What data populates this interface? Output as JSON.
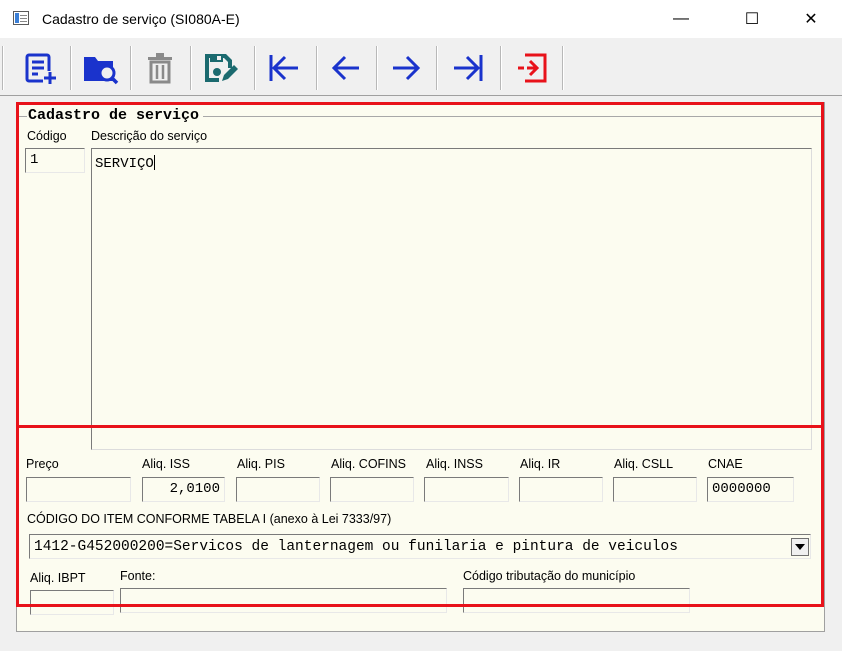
{
  "window": {
    "title": "Cadastro de serviço  (SI080A-E)",
    "controls": {
      "minimize": "—",
      "maximize": "☐",
      "close": "✕"
    }
  },
  "toolbar": {
    "buttons": [
      {
        "name": "novo",
        "icon": "new-record-icon",
        "color": "#1a33cc"
      },
      {
        "name": "pesquisar",
        "icon": "search-folder-icon",
        "color": "#1a33cc"
      },
      {
        "name": "excluir",
        "icon": "trash-icon",
        "color": "#8a8a8a"
      },
      {
        "name": "gravar",
        "icon": "save-edit-icon",
        "color": "#1b6a6f"
      },
      {
        "name": "primeiro",
        "icon": "first-record-icon",
        "color": "#1a33cc"
      },
      {
        "name": "anterior",
        "icon": "previous-record-icon",
        "color": "#1a33cc"
      },
      {
        "name": "proximo",
        "icon": "next-record-icon",
        "color": "#1a33cc"
      },
      {
        "name": "ultimo",
        "icon": "last-record-icon",
        "color": "#1a33cc"
      },
      {
        "name": "sair",
        "icon": "exit-icon",
        "color": "#e8121a"
      }
    ]
  },
  "form": {
    "group_title": "Cadastro de serviço",
    "codigo": {
      "label": "Código",
      "value": "1"
    },
    "descricao": {
      "label": "Descrição do serviço",
      "value": "SERVIÇO"
    },
    "preco": {
      "label": "Preço",
      "value": ""
    },
    "aliq_iss": {
      "label": "Aliq. ISS",
      "value": "2,0100"
    },
    "aliq_pis": {
      "label": "Aliq. PIS",
      "value": ""
    },
    "aliq_cofins": {
      "label": "Aliq. COFINS",
      "value": ""
    },
    "aliq_inss": {
      "label": "Aliq. INSS",
      "value": ""
    },
    "aliq_ir": {
      "label": "Aliq. IR",
      "value": ""
    },
    "aliq_csll": {
      "label": "Aliq. CSLL",
      "value": ""
    },
    "cnae": {
      "label": "CNAE",
      "value": "0000000"
    },
    "codigo_item": {
      "label": "CÓDIGO DO ITEM CONFORME TABELA I (anexo à Lei 7333/97)",
      "value": "1412-G452000200=Servicos de lanternagem ou funilaria e pintura de veiculos"
    },
    "aliq_ibpt": {
      "label": "Aliq. IBPT",
      "value": ""
    },
    "fonte": {
      "label": "Fonte:",
      "value": ""
    },
    "codigo_tributacao": {
      "label": "Código tributação do município",
      "value": ""
    }
  },
  "colors": {
    "highlight": "#e8121a",
    "field_bg": "#fcfcf0"
  }
}
